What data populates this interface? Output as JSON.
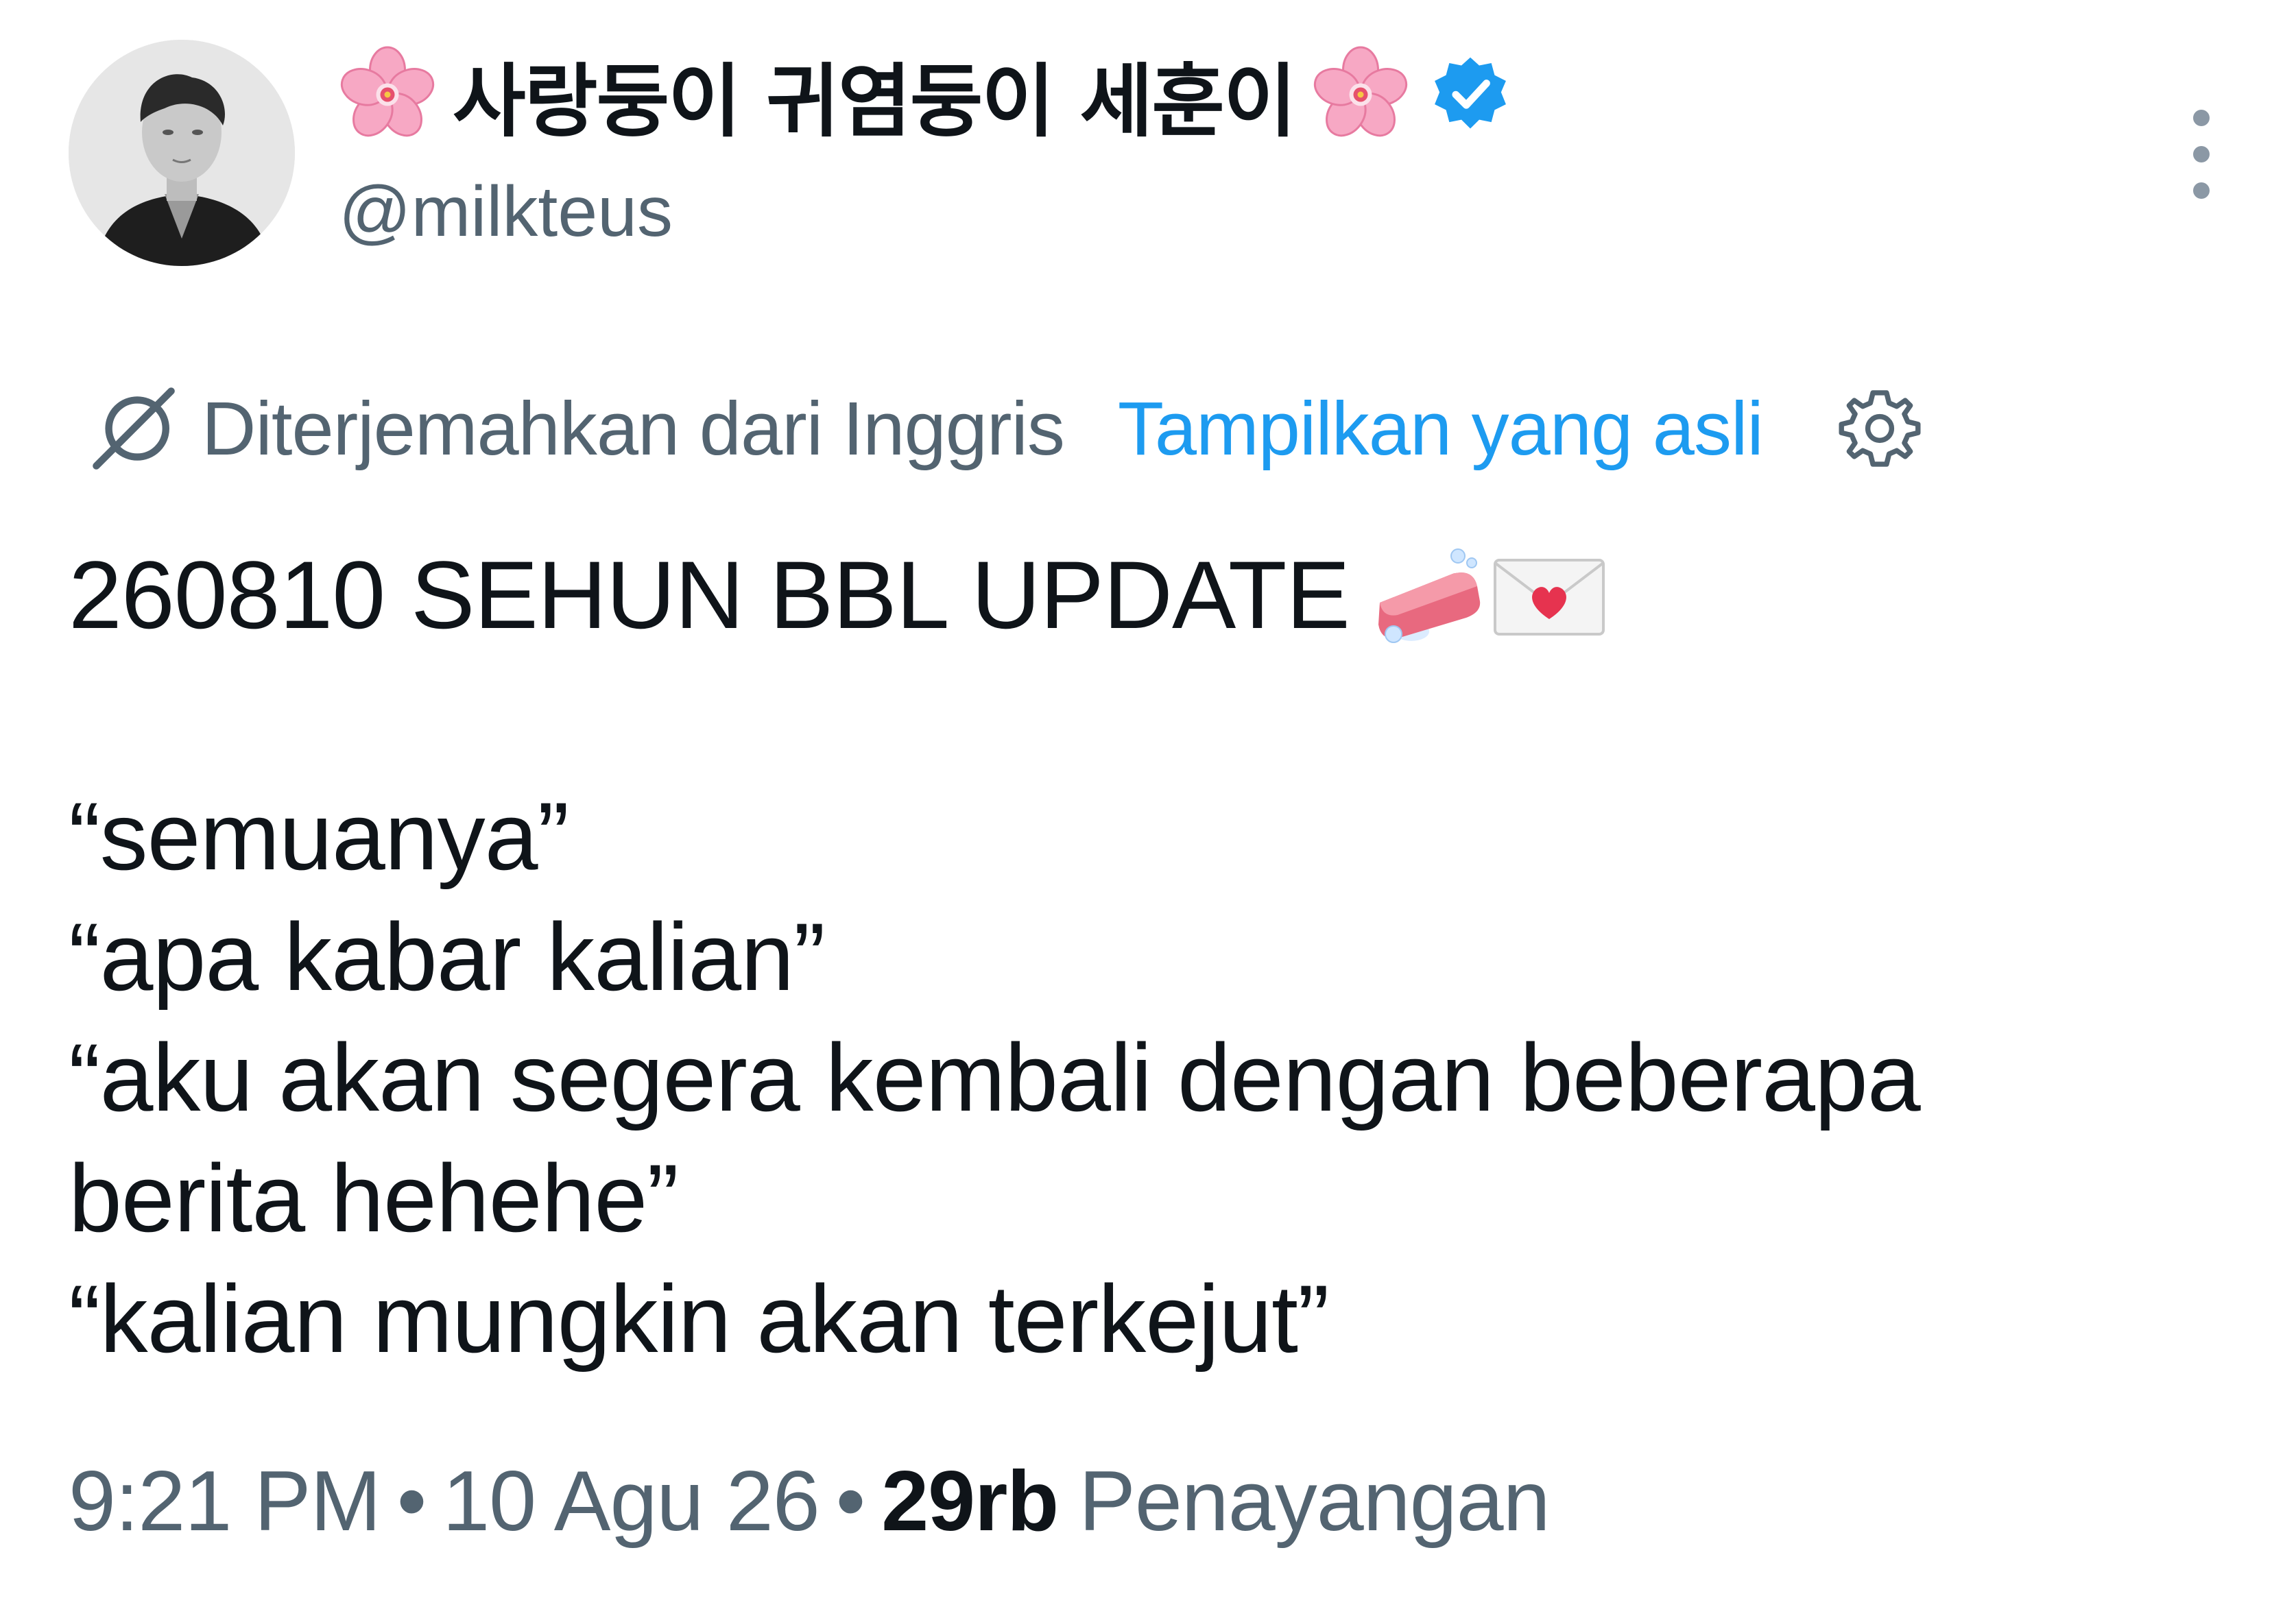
{
  "author": {
    "display_name": "사랑둥이 귀염둥이 세훈이",
    "handle": "@milkteus",
    "verified": true,
    "name_decoration_icon": "cherry-blossom-icon",
    "verified_icon": "verified-badge-icon",
    "verified_color": "#1d9bf0"
  },
  "menu": {
    "icon": "more-options-icon"
  },
  "translation": {
    "icon": "globe-icon",
    "translated_from": "Diterjemahkan dari Inggris",
    "show_original": "Tampilkan yang asli",
    "settings_icon": "gear-icon",
    "link_color": "#1d9bf0"
  },
  "tweet": {
    "title": "260810 SEHUN BBL UPDATE",
    "title_emojis": [
      "soap-icon",
      "love-letter-icon"
    ],
    "lines": [
      "“semuanya”",
      "“apa kabar kalian”",
      "“aku akan segera kembali dengan beberapa",
      "berita hehehe”",
      "“kalian mungkin akan terkejut”"
    ]
  },
  "meta": {
    "time": "9:21 PM",
    "date": "10 Agu 26",
    "separator": "•",
    "views_count": "29rb",
    "views_label": "Penayangan"
  }
}
